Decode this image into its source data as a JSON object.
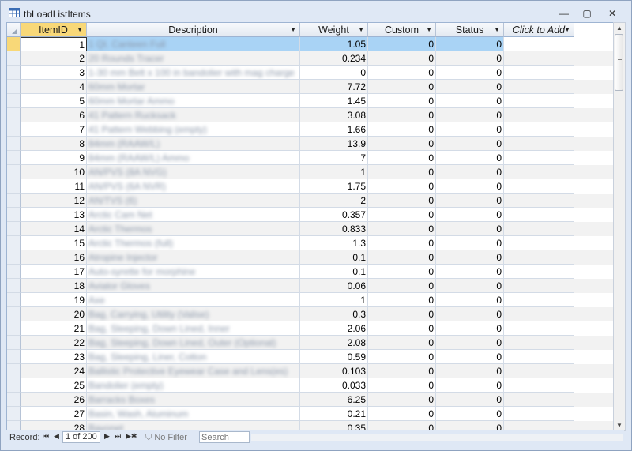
{
  "window": {
    "title": "tbLoadListItems",
    "minimize_glyph": "—",
    "maximize_glyph": "▢",
    "close_glyph": "✕"
  },
  "columns": [
    {
      "key": "id",
      "label": "ItemID"
    },
    {
      "key": "desc",
      "label": "Description"
    },
    {
      "key": "weight",
      "label": "Weight"
    },
    {
      "key": "custom",
      "label": "Custom"
    },
    {
      "key": "status",
      "label": "Status"
    },
    {
      "key": "add",
      "label": "Click to Add"
    }
  ],
  "rows": [
    {
      "id": "1",
      "desc": "1 Qt. Canteen Full",
      "weight": "1.05",
      "custom": "0",
      "status": "0"
    },
    {
      "id": "2",
      "desc": "20 Rounds Tracer",
      "weight": "0.234",
      "custom": "0",
      "status": "0"
    },
    {
      "id": "3",
      "desc": "1-30 mm Belt x 100 in bandolier with mag charge",
      "weight": "0",
      "custom": "0",
      "status": "0"
    },
    {
      "id": "4",
      "desc": "60mm Mortar",
      "weight": "7.72",
      "custom": "0",
      "status": "0"
    },
    {
      "id": "5",
      "desc": "60mm Mortar Ammo",
      "weight": "1.45",
      "custom": "0",
      "status": "0"
    },
    {
      "id": "6",
      "desc": "41 Pattern Rucksack",
      "weight": "3.08",
      "custom": "0",
      "status": "0"
    },
    {
      "id": "7",
      "desc": "41 Pattern Webbing (empty)",
      "weight": "1.66",
      "custom": "0",
      "status": "0"
    },
    {
      "id": "8",
      "desc": "84mm (RAAW/L)",
      "weight": "13.9",
      "custom": "0",
      "status": "0"
    },
    {
      "id": "9",
      "desc": "84mm (RAAW/L) Ammo",
      "weight": "7",
      "custom": "0",
      "status": "0"
    },
    {
      "id": "10",
      "desc": "AN/PVS (8A NVG)",
      "weight": "1",
      "custom": "0",
      "status": "0"
    },
    {
      "id": "11",
      "desc": "AN/PVS (6A NVR)",
      "weight": "1.75",
      "custom": "0",
      "status": "0"
    },
    {
      "id": "12",
      "desc": "AN/TVS (6)",
      "weight": "2",
      "custom": "0",
      "status": "0"
    },
    {
      "id": "13",
      "desc": "Arctic Cam Net",
      "weight": "0.357",
      "custom": "0",
      "status": "0"
    },
    {
      "id": "14",
      "desc": "Arctic Thermos",
      "weight": "0.833",
      "custom": "0",
      "status": "0"
    },
    {
      "id": "15",
      "desc": "Arctic Thermos (full)",
      "weight": "1.3",
      "custom": "0",
      "status": "0"
    },
    {
      "id": "16",
      "desc": "Atropine Injector",
      "weight": "0.1",
      "custom": "0",
      "status": "0"
    },
    {
      "id": "17",
      "desc": "Auto-syrette for morphine",
      "weight": "0.1",
      "custom": "0",
      "status": "0"
    },
    {
      "id": "18",
      "desc": "Aviator Gloves",
      "weight": "0.06",
      "custom": "0",
      "status": "0"
    },
    {
      "id": "19",
      "desc": "Axe",
      "weight": "1",
      "custom": "0",
      "status": "0"
    },
    {
      "id": "20",
      "desc": "Bag, Carrying, Utility (Valise)",
      "weight": "0.3",
      "custom": "0",
      "status": "0"
    },
    {
      "id": "21",
      "desc": "Bag, Sleeping, Down Lined, Inner",
      "weight": "2.06",
      "custom": "0",
      "status": "0"
    },
    {
      "id": "22",
      "desc": "Bag, Sleeping, Down Lined, Outer (Optional)",
      "weight": "2.08",
      "custom": "0",
      "status": "0"
    },
    {
      "id": "23",
      "desc": "Bag, Sleeping, Liner, Cotton",
      "weight": "0.59",
      "custom": "0",
      "status": "0"
    },
    {
      "id": "24",
      "desc": "Ballistic Protective Eyewear Case and Lens(es)",
      "weight": "0.103",
      "custom": "0",
      "status": "0"
    },
    {
      "id": "25",
      "desc": "Bandolier (empty)",
      "weight": "0.033",
      "custom": "0",
      "status": "0"
    },
    {
      "id": "26",
      "desc": "Barracks Boxes",
      "weight": "6.25",
      "custom": "0",
      "status": "0"
    },
    {
      "id": "27",
      "desc": "Basin, Wash, Aluminum",
      "weight": "0.21",
      "custom": "0",
      "status": "0"
    },
    {
      "id": "28",
      "desc": "Bayonet",
      "weight": "0.35",
      "custom": "0",
      "status": "0"
    }
  ],
  "navigation": {
    "record_label": "Record:",
    "position": "1 of 200",
    "first_glyph": "⏮",
    "prev_glyph": "◀",
    "next_glyph": "▶",
    "last_glyph": "⏭",
    "new_glyph": "▶✱",
    "no_filter_label": "No Filter",
    "search_placeholder": "Search"
  },
  "colors": {
    "selection": "#a9d3f5",
    "current_header": "#f8d878"
  }
}
